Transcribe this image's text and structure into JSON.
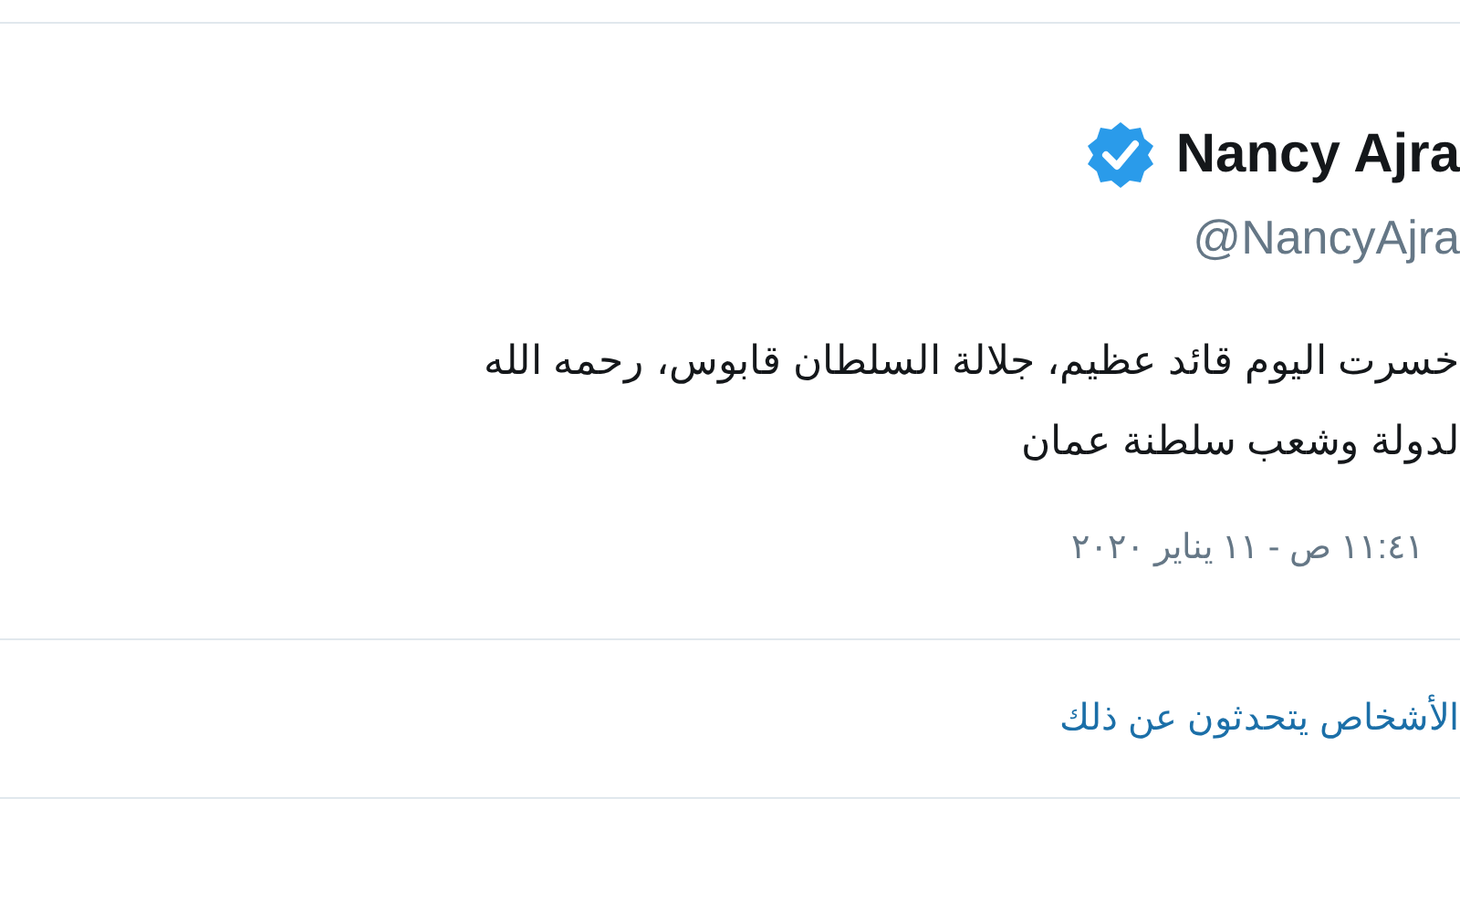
{
  "author": {
    "name": "Nancy Ajra",
    "verified": true,
    "handle": "@NancyAjra"
  },
  "tweet": {
    "lines": [
      "خسرت اليوم قائد عظيم، جلالة السلطان قابوس، رحمه الله",
      "لدولة وشعب سلطنة عمان"
    ],
    "timestamp": "١١:٤١ ص - ١١ يناير ٢٠٢٠"
  },
  "footer_link": "الأشخاص يتحدثون عن ذلك"
}
